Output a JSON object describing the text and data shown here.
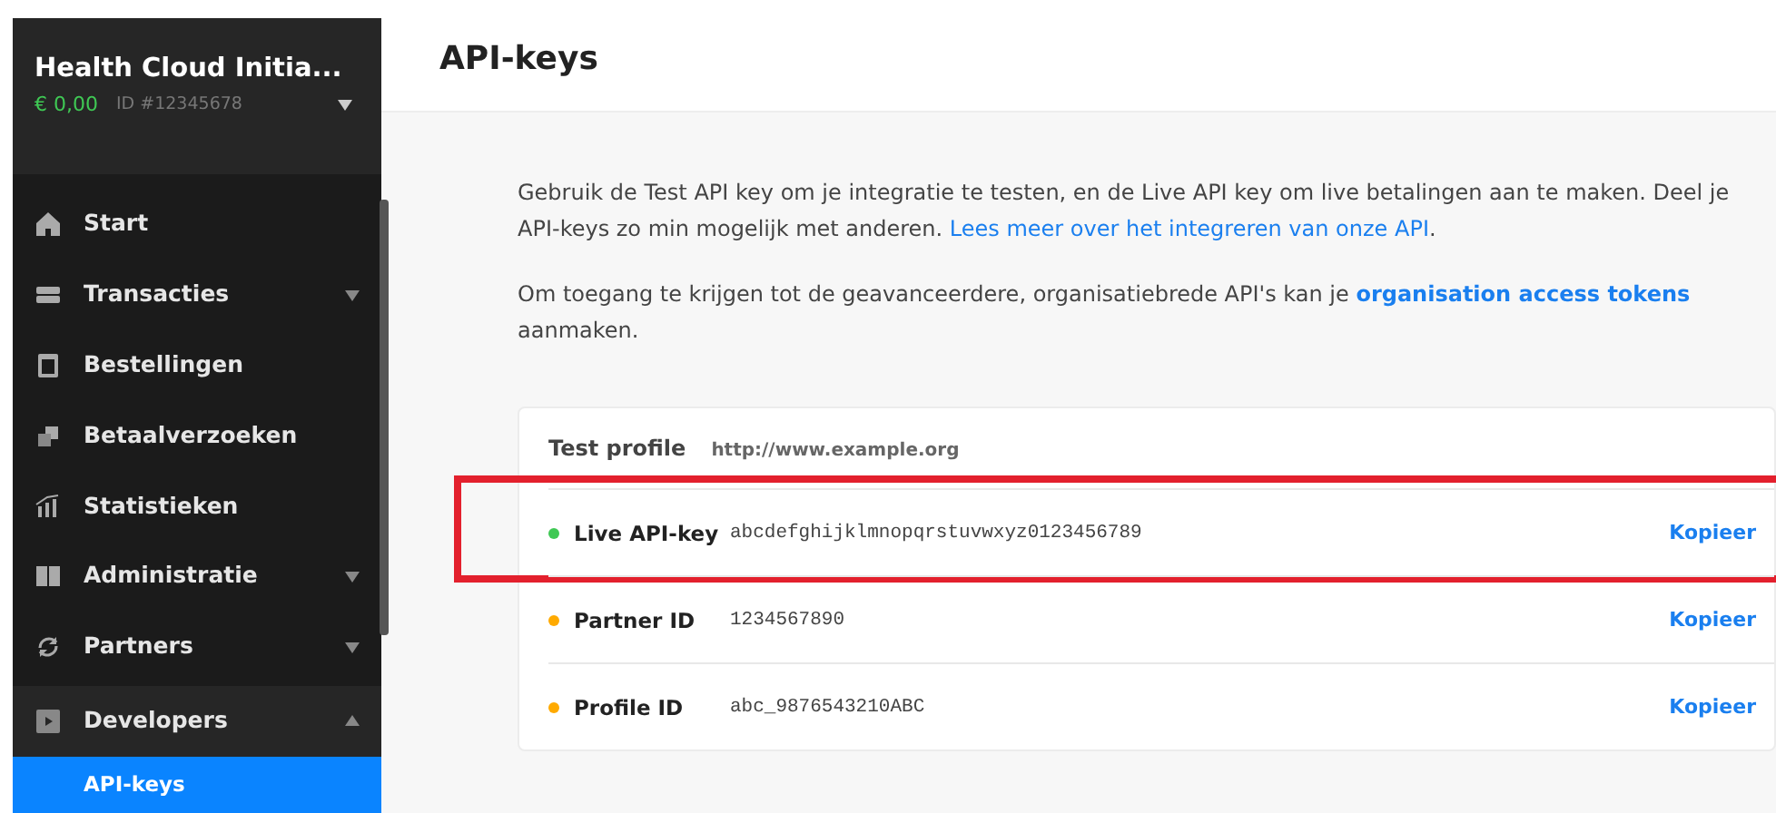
{
  "account": {
    "name": "Health Cloud Initia...",
    "balance": "€ 0,00",
    "id": "ID #12345678"
  },
  "sidebar": {
    "items": [
      {
        "label": "Start",
        "submenu": false,
        "expanded": false,
        "selected": false
      },
      {
        "label": "Transacties",
        "submenu": true,
        "expanded": false,
        "selected": false
      },
      {
        "label": "Bestellingen",
        "submenu": false,
        "expanded": false,
        "selected": false
      },
      {
        "label": "Betaalverzoeken",
        "submenu": false,
        "expanded": false,
        "selected": false
      },
      {
        "label": "Statistieken",
        "submenu": false,
        "expanded": false,
        "selected": false
      },
      {
        "label": "Administratie",
        "submenu": true,
        "expanded": false,
        "selected": false
      },
      {
        "label": "Partners",
        "submenu": true,
        "expanded": false,
        "selected": false
      },
      {
        "label": "Developers",
        "submenu": true,
        "expanded": true,
        "selected": false,
        "children": [
          {
            "label": "API-keys",
            "selected": true
          }
        ]
      }
    ]
  },
  "page": {
    "title": "API-keys",
    "intro": "Gebruik de Test API key om je integratie te testen, en de Live API key om live betalingen aan te maken. Deel je API-keys zo min mogelijk met anderen.",
    "intro_link": "Lees meer over het integreren van onze API",
    "intro_end": ".",
    "access_text": "Om toegang te krijgen tot de geavanceerdere, organisatiebrede API's kan je",
    "access_link": "organisation access tokens",
    "access_end": "aanmaken."
  },
  "profile": {
    "name": "Test profile",
    "url": "http://www.example.org",
    "keys": [
      {
        "label": "Live API-key",
        "value": "abcdefghijklmnopqrstuvwxyz0123456789",
        "color": "#3fc854",
        "action": "Kopieer",
        "highlighted": true
      },
      {
        "label": "Partner ID",
        "value": "1234567890",
        "color": "#ffaa00",
        "action": "Kopieer",
        "highlighted": false
      },
      {
        "label": "Profile ID",
        "value": "abc_9876543210ABC",
        "color": "#ffaa00",
        "action": "Kopieer",
        "highlighted": false
      }
    ]
  }
}
